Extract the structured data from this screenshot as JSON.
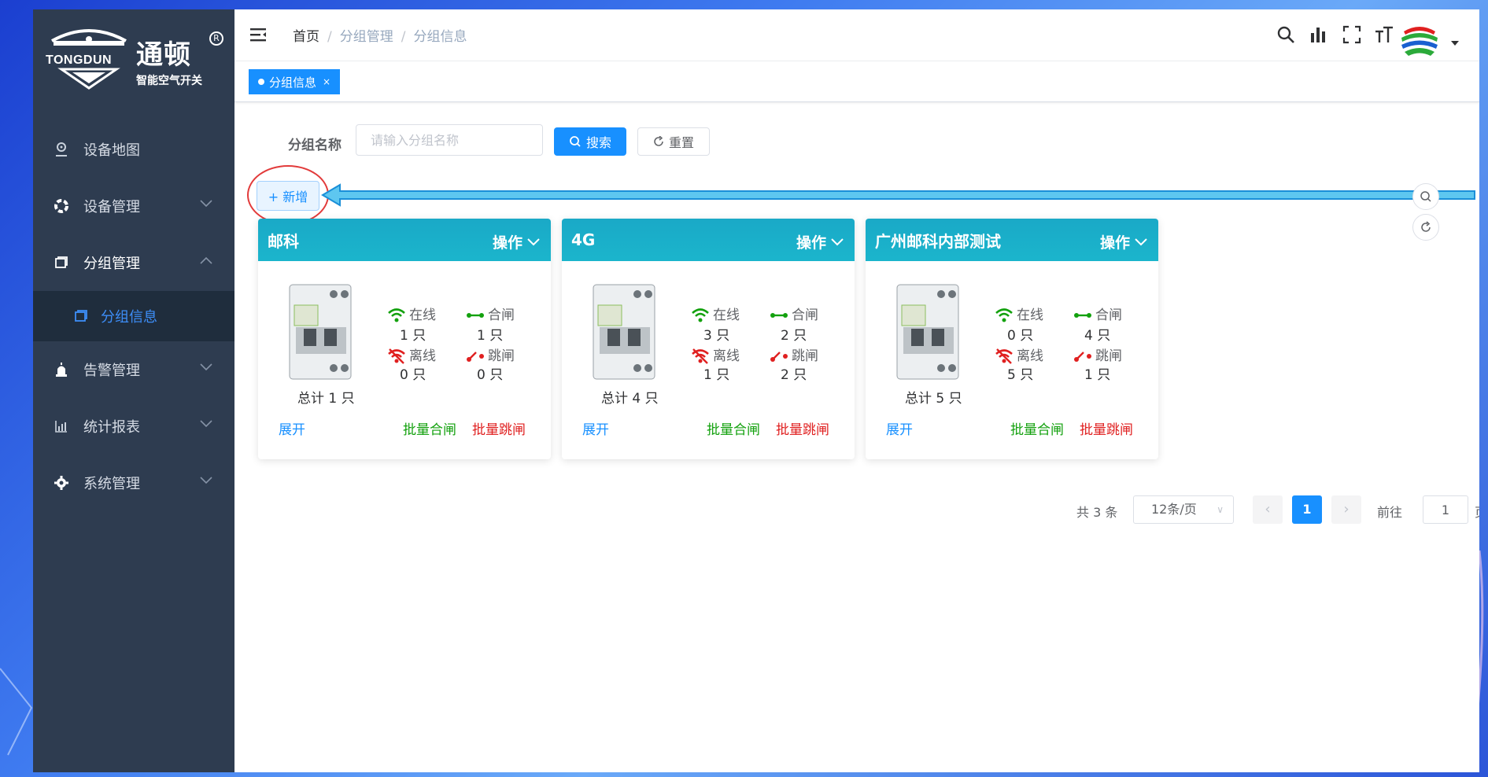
{
  "brand": {
    "name_en": "TONGDUN",
    "name_cn": "通顿",
    "tagline": "智能空气开关",
    "reg": "R"
  },
  "sidebar": {
    "items": [
      {
        "label": "设备地图",
        "icon": "location-icon",
        "expandable": false
      },
      {
        "label": "设备管理",
        "icon": "device-settings-icon",
        "expandable": true
      },
      {
        "label": "分组管理",
        "icon": "group-icon",
        "expandable": true,
        "open": true
      },
      {
        "label": "告警管理",
        "icon": "alarm-icon",
        "expandable": true
      },
      {
        "label": "统计报表",
        "icon": "chart-icon",
        "expandable": true
      },
      {
        "label": "系统管理",
        "icon": "gear-icon",
        "expandable": true
      }
    ],
    "subitem": {
      "label": "分组信息",
      "icon": "group-icon"
    }
  },
  "breadcrumb": [
    "首页",
    "分组管理",
    "分组信息"
  ],
  "tag": {
    "label": "分组信息",
    "close": "×"
  },
  "search": {
    "label": "分组名称",
    "placeholder": "请输入分组名称",
    "search_btn": "搜索",
    "reset_btn": "重置"
  },
  "add_btn": "+ 新增",
  "cards": [
    {
      "title": "邮科",
      "op": "操作",
      "online_label": "在线",
      "online": "1 只",
      "closed_label": "合闸",
      "closed": "1 只",
      "offline_label": "离线",
      "offline": "0 只",
      "tripped_label": "跳闸",
      "tripped": "0 只",
      "total": "总计 1 只",
      "expand": "展开",
      "batch_close": "批量合闸",
      "batch_trip": "批量跳闸"
    },
    {
      "title": "4G",
      "op": "操作",
      "online_label": "在线",
      "online": "3 只",
      "closed_label": "合闸",
      "closed": "2 只",
      "offline_label": "离线",
      "offline": "1 只",
      "tripped_label": "跳闸",
      "tripped": "2 只",
      "total": "总计 4 只",
      "expand": "展开",
      "batch_close": "批量合闸",
      "batch_trip": "批量跳闸"
    },
    {
      "title": "广州邮科内部测试",
      "op": "操作",
      "online_label": "在线",
      "online": "0 只",
      "closed_label": "合闸",
      "closed": "4 只",
      "offline_label": "离线",
      "offline": "5 只",
      "tripped_label": "跳闸",
      "tripped": "1 只",
      "total": "总计 5 只",
      "expand": "展开",
      "batch_close": "批量合闸",
      "batch_trip": "批量跳闸"
    }
  ],
  "pagination": {
    "total": "共 3 条",
    "page_size": "12条/页",
    "current": "1",
    "goto_label": "前往",
    "goto_value": "1",
    "page_suffix": "页"
  },
  "colors": {
    "sidebar_bg": "#2e3c50",
    "primary": "#1890ff",
    "card_head": "#1bb5cc",
    "green": "#13a10e",
    "red": "#e02020"
  }
}
